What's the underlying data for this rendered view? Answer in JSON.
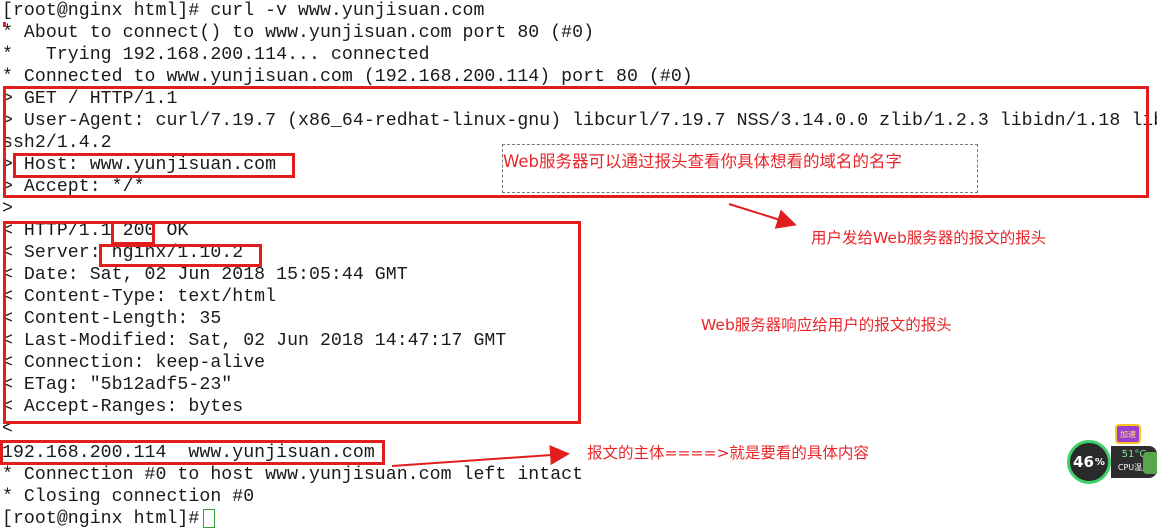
{
  "terminal": {
    "lines": [
      "[root@nginx html]# curl -v www.yunjisuan.com",
      "* About to connect() to www.yunjisuan.com port 80 (#0)",
      "*   Trying 192.168.200.114... connected",
      "* Connected to www.yunjisuan.com (192.168.200.114) port 80 (#0)",
      "> GET / HTTP/1.1",
      "> User-Agent: curl/7.19.7 (x86_64-redhat-linux-gnu) libcurl/7.19.7 NSS/3.14.0.0 zlib/1.2.3 libidn/1.18 lib",
      "ssh2/1.4.2",
      "> Host: www.yunjisuan.com",
      "> Accept: */*",
      ">",
      "< HTTP/1.1 200 OK",
      "< Server: nginx/1.10.2",
      "< Date: Sat, 02 Jun 2018 15:05:44 GMT",
      "< Content-Type: text/html",
      "< Content-Length: 35",
      "< Last-Modified: Sat, 02 Jun 2018 14:47:17 GMT",
      "< Connection: keep-alive",
      "< ETag: \"5b12adf5-23\"",
      "< Accept-Ranges: bytes",
      "<",
      "192.168.200.114  www.yunjisuan.com",
      "* Connection #0 to host www.yunjisuan.com left intact",
      "* Closing connection #0",
      "[root@nginx html]# "
    ]
  },
  "annotations": {
    "host_note": "Web服务器可以通过报头查看你具体想看的域名的名字",
    "request_header_note": "用户发给Web服务器的报文的报头",
    "response_header_note": "Web服务器响应给用户的报文的报头",
    "body_note": "报文的主体====>就是要看的具体内容",
    "color": "#e21d1d"
  },
  "system_widget": {
    "cpu_usage": "46",
    "cpu_usage_unit": "%",
    "temperature": "51°C",
    "temperature_label": "CPU温度",
    "badge_label": "加速",
    "ring_color": "#3fd06a"
  }
}
